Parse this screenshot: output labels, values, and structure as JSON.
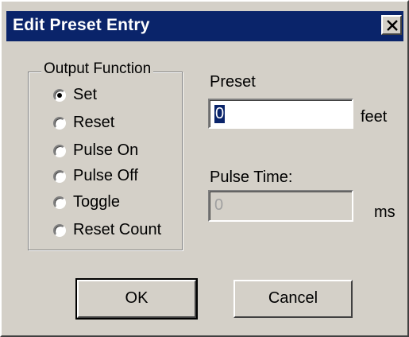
{
  "window": {
    "title": "Edit Preset Entry",
    "close_glyph": "×"
  },
  "output_function": {
    "legend": "Output Function",
    "options": [
      {
        "label": "Set",
        "selected": true
      },
      {
        "label": "Reset",
        "selected": false
      },
      {
        "label": "Pulse On",
        "selected": false
      },
      {
        "label": "Pulse Off",
        "selected": false
      },
      {
        "label": "Toggle",
        "selected": false
      },
      {
        "label": "Reset Count",
        "selected": false
      }
    ]
  },
  "preset": {
    "label": "Preset",
    "value": "0",
    "unit": "feet"
  },
  "pulse_time": {
    "label": "Pulse Time:",
    "value": "0",
    "unit": "ms"
  },
  "buttons": {
    "ok": "OK",
    "cancel": "Cancel"
  },
  "colors": {
    "title_bar": "#0a246a",
    "face": "#d4d0c8"
  }
}
